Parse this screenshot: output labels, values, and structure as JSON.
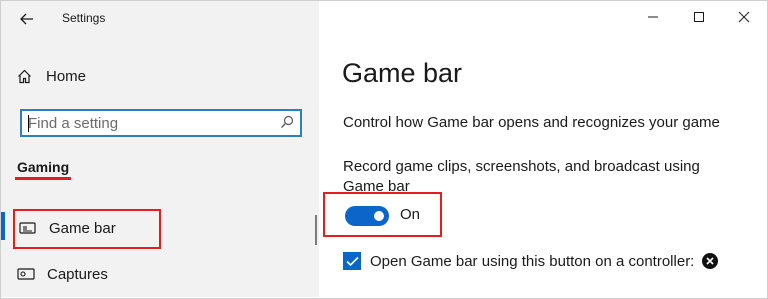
{
  "window": {
    "title": "Settings",
    "controls": [
      "minimize",
      "maximize",
      "close"
    ]
  },
  "sidebar": {
    "home_label": "Home",
    "search_placeholder": "Find a setting",
    "section_heading": "Gaming",
    "items": [
      {
        "label": "Game bar",
        "icon": "game-bar-icon",
        "selected": true
      },
      {
        "label": "Captures",
        "icon": "captures-icon",
        "selected": false
      }
    ]
  },
  "main": {
    "title": "Game bar",
    "description": "Control how Game bar opens and recognizes your game",
    "record_label": "Record game clips, screenshots, and broadcast using Game bar",
    "toggle": {
      "state": "On",
      "on": true
    },
    "checkbox": {
      "label": "Open Game bar using this button on a controller:",
      "checked": true
    }
  },
  "colors": {
    "accent": "#0a67c9",
    "highlight": "#e41e1e",
    "sidebar_bg": "#f2f2f2"
  }
}
